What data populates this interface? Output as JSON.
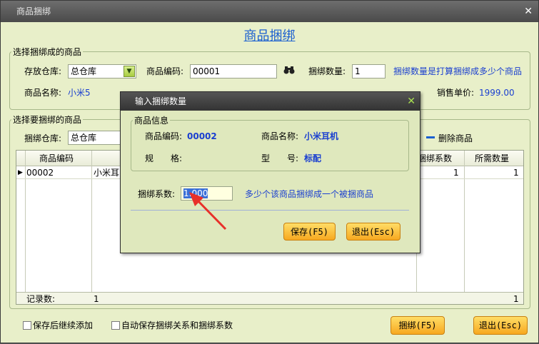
{
  "window": {
    "title": "商品捆绑",
    "close_symbol": "✕"
  },
  "header": {
    "title": "商品捆绑"
  },
  "top_group": {
    "legend": "选择捆绑成的商品",
    "warehouse_label": "存放仓库:",
    "warehouse_value": "总仓库",
    "code_label": "商品编码:",
    "code_value": "00001",
    "qty_label": "捆绑数量:",
    "qty_value": "1",
    "qty_hint": "捆绑数量是打算捆绑成多少个商品",
    "name_label": "商品名称:",
    "name_value": "小米5",
    "price_label": "销售单价:",
    "price_value": "1999.00"
  },
  "bottom_group": {
    "legend": "选择要捆绑的商品",
    "warehouse_label": "捆绑仓库:",
    "warehouse_value": "总仓库",
    "delete_label": "删除商品",
    "columns": {
      "code": "商品编码",
      "coef": "捆绑系数",
      "need": "所需数量"
    },
    "row": {
      "code": "00002",
      "name": "小米耳",
      "coef": "1",
      "need": "1"
    },
    "footer": {
      "label": "记录数:",
      "count": "1",
      "total": "1"
    }
  },
  "footer": {
    "continue_add": "保存后继续添加",
    "auto_save": "自动保存捆绑关系和捆绑系数",
    "bundle_button": "捆绑(F5)",
    "exit_button": "退出(Esc)"
  },
  "dialog": {
    "title": "输入捆绑数量",
    "group_legend": "商品信息",
    "code_label": "商品编码:",
    "code_value": "00002",
    "name_label": "商品名称:",
    "name_value": "小米耳机",
    "spec_label": "规　　格:",
    "spec_value": "",
    "model_label": "型　　号:",
    "model_value": "标配",
    "coef_label": "捆绑系数:",
    "coef_value": "1.000",
    "coef_hint": "多少个该商品捆绑成一个被捆商品",
    "save_button": "保存(F5)",
    "exit_button": "退出(Esc)"
  },
  "colors": {
    "accent_blue": "#1a3fd0",
    "button_orange": "#f7a820",
    "annotation_red": "#e8302a"
  }
}
